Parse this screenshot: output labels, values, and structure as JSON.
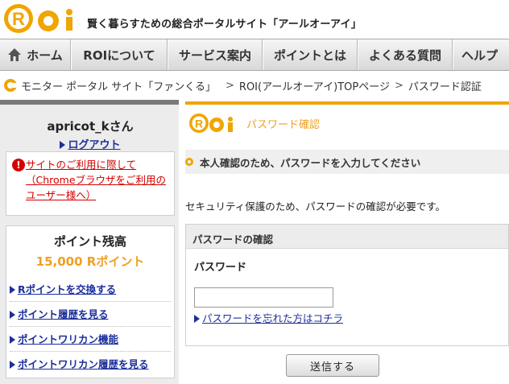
{
  "header": {
    "logo_text": "ROi",
    "tagline": "賢く暮らすための総合ポータルサイト「アールオーアイ」"
  },
  "nav": {
    "items": [
      {
        "label": "ホーム"
      },
      {
        "label": "ROIについて"
      },
      {
        "label": "サービス案内"
      },
      {
        "label": "ポイントとは"
      },
      {
        "label": "よくある質問"
      },
      {
        "label": "ヘルプ"
      }
    ]
  },
  "breadcrumb": {
    "items": [
      "モニター ポータル サイト「ファンくる」",
      "ROI(アールオーアイ)TOPページ",
      "パスワード認証"
    ],
    "separator": ">"
  },
  "sidebar": {
    "username": "apricot_kさん",
    "logout": "ログアウト",
    "notice": "サイトのご利用に際して（Chromeブラウザをご利用のユーザー様へ）",
    "points": {
      "title": "ポイント残高",
      "value": "15,000 Rポイント",
      "links": [
        "Rポイントを交換する",
        "ポイント履歴を見る",
        "ポイントワリカン機能",
        "ポイントワリカン履歴を見る"
      ]
    }
  },
  "main": {
    "title": "パスワード確認",
    "subtitle": "本人確認のため、パスワードを入力してください",
    "description": "セキュリティ保護のため、パスワードの確認が必要です。",
    "form": {
      "section_title": "パスワードの確認",
      "field_label": "パスワード",
      "field_value": "",
      "forgot_link": "パスワードを忘れた方はコチラ"
    },
    "submit_label": "送信する"
  },
  "colors": {
    "accent": "#f0a500",
    "link": "#1c2f9c",
    "alert": "#d40000"
  }
}
